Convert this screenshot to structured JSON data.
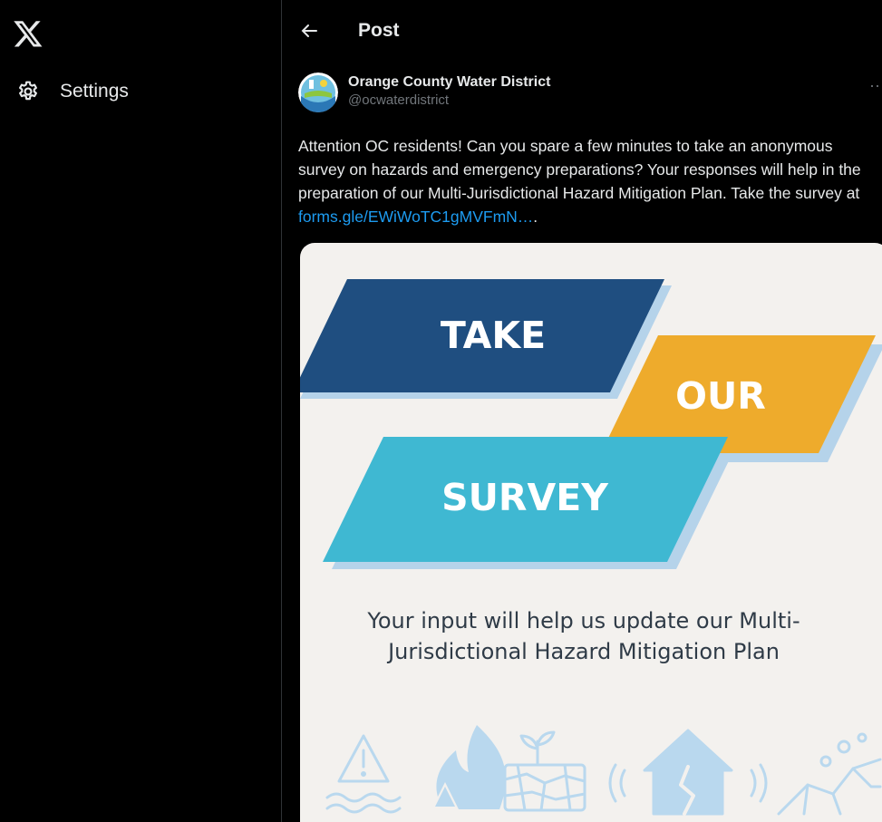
{
  "sidebar": {
    "logo": "x-logo-icon",
    "settings_icon": "gear-icon",
    "settings_label": "Settings"
  },
  "header": {
    "back_icon": "arrow-left-icon",
    "title": "Post"
  },
  "post": {
    "author_name": "Orange County Water District",
    "author_handle": "@ocwaterdistrict",
    "more_icon": "more-icon",
    "text": "Attention OC residents! Can you spare a few minutes to take an anonymous survey on hazards and emergency preparations? Your responses will help in the preparation of our Multi-Jurisdictional Hazard Mitigation Plan. Take the survey at ",
    "link": "forms.gle/EWiWoTC1gMVFmN…",
    "link_suffix": "."
  },
  "image": {
    "word1": "TAKE",
    "word2": "OUR",
    "word3": "SURVEY",
    "caption_line1": "Your input will help us update our Multi-",
    "caption_line2": "Jurisdictional Hazard Mitigation Plan",
    "icons": [
      "warning-flood-icon",
      "wildfire-icon",
      "drought-icon",
      "earthquake-house-icon",
      "landslide-icon"
    ]
  },
  "colors": {
    "background": "#000000",
    "link": "#1d9bf0",
    "navy": "#1f4e80",
    "orange": "#eeab2c",
    "cyan": "#3fb8d2",
    "shadow": "#b5d3ea"
  }
}
